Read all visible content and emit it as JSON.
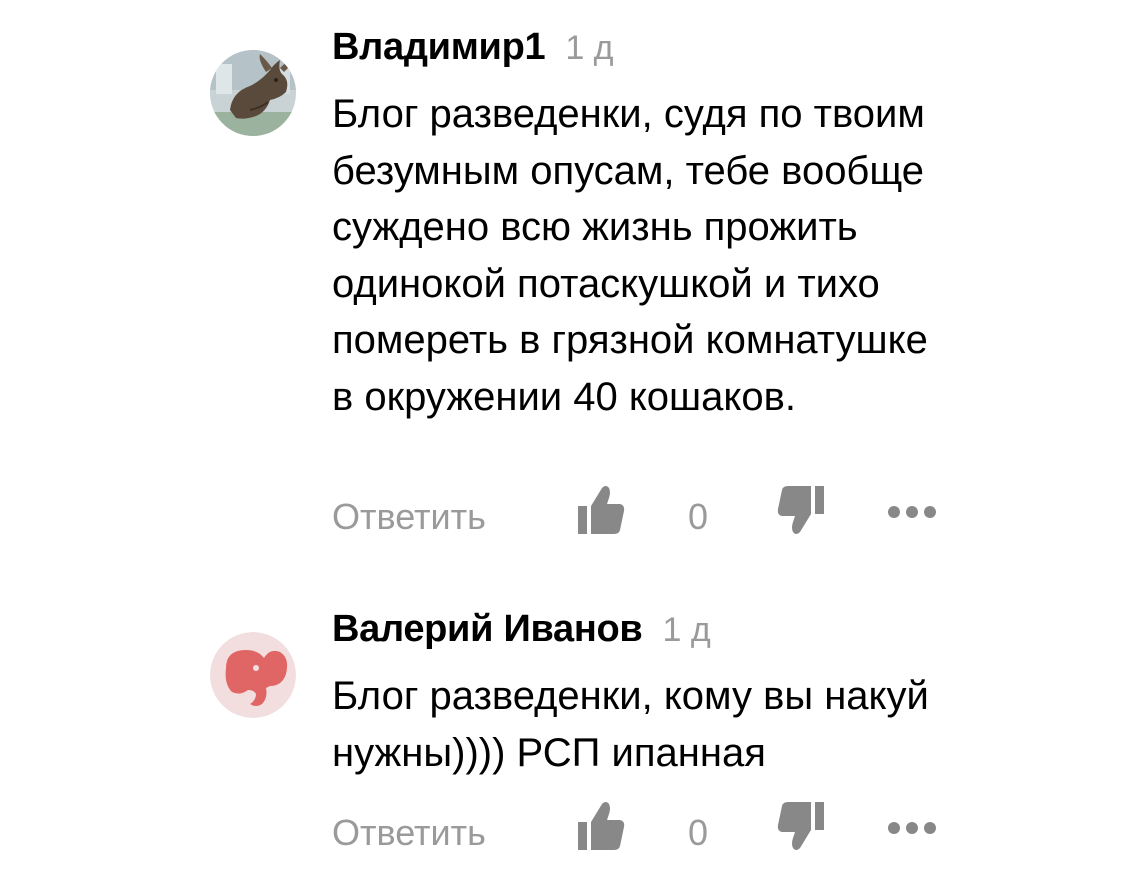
{
  "comments": [
    {
      "author": "Владимир1",
      "age": "1 д",
      "text_lines": [
        "Блог разведенки, судя по твоим",
        "безумным опусам, тебе вообще",
        "суждено всю жизнь прожить",
        "одинокой потаскушкой и тихо",
        "помереть в грязной комнатушке",
        "в окружении 40 кошаков."
      ],
      "reply_label": "Ответить",
      "like_count": "0",
      "avatar_icon": "bull-statue-avatar"
    },
    {
      "author": "Валерий Иванов",
      "age": "1 д",
      "text_lines": [
        "Блог разведенки, кому вы накуй",
        "нужны)))) РСП ипанная"
      ],
      "reply_label": "Ответить",
      "like_count": "0",
      "avatar_icon": "elephant-avatar"
    }
  ],
  "colors": {
    "text": "#000000",
    "muted": "#9a9a9a",
    "action_icon": "#888888",
    "elephant_bg": "#f2dede",
    "elephant": "#e06666"
  }
}
